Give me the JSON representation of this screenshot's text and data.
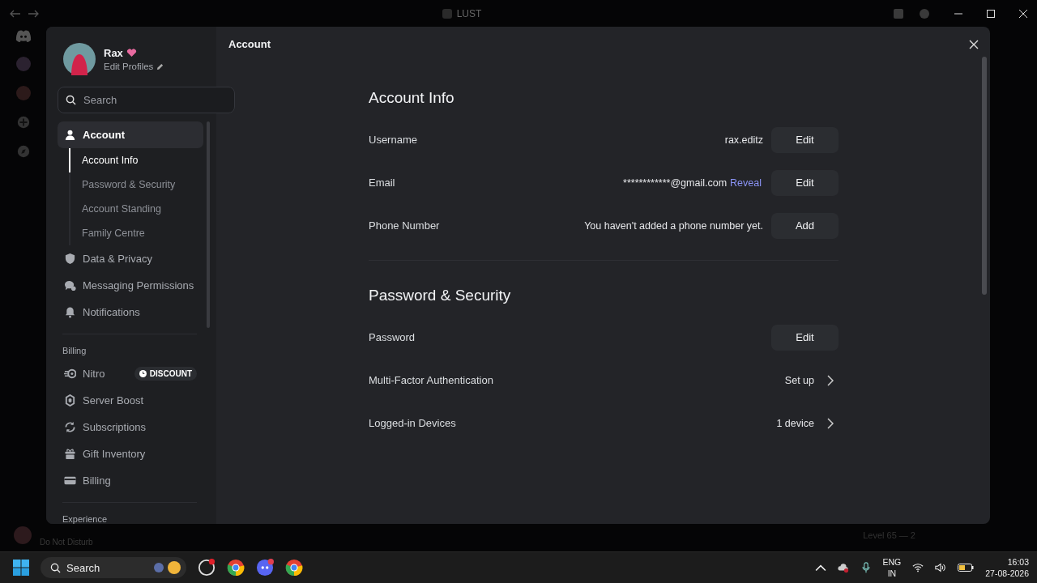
{
  "window": {
    "title": "LUST"
  },
  "background": {
    "status": "Do Not Disturb",
    "level_text": "Level 65 — 2"
  },
  "settings": {
    "profile": {
      "name": "Rax",
      "link": "Edit Profiles"
    },
    "search": {
      "placeholder": "Search"
    },
    "sections": [
      {
        "items": [
          {
            "label": "Account",
            "selected": true,
            "children": [
              {
                "label": "Account Info",
                "selected": true
              },
              {
                "label": "Password & Security",
                "selected": false
              },
              {
                "label": "Account Standing",
                "selected": false
              },
              {
                "label": "Family Centre",
                "selected": false
              }
            ]
          },
          {
            "label": "Data & Privacy",
            "selected": false
          },
          {
            "label": "Messaging Permissions",
            "selected": false
          },
          {
            "label": "Notifications",
            "selected": false
          }
        ]
      },
      {
        "header": "Billing",
        "items": [
          {
            "label": "Nitro",
            "selected": false,
            "badge": "DISCOUNT"
          },
          {
            "label": "Server Boost",
            "selected": false
          },
          {
            "label": "Subscriptions",
            "selected": false
          },
          {
            "label": "Gift Inventory",
            "selected": false
          },
          {
            "label": "Billing",
            "selected": false
          }
        ]
      },
      {
        "header": "Experience"
      }
    ],
    "page_title": "Account",
    "groups": [
      {
        "title": "Account Info",
        "rows": [
          {
            "kind": "button",
            "label": "Username",
            "value": "rax.editz",
            "action": "Edit"
          },
          {
            "kind": "button",
            "label": "Email",
            "value": "************@gmail.com",
            "link": "Reveal",
            "action": "Edit"
          },
          {
            "kind": "button",
            "label": "Phone Number",
            "value": "You haven't added a phone number yet.",
            "action": "Add"
          }
        ]
      },
      {
        "title": "Password & Security",
        "rows": [
          {
            "kind": "button",
            "label": "Password",
            "action": "Edit"
          },
          {
            "kind": "chevron",
            "label": "Multi-Factor Authentication",
            "value": "Set up"
          },
          {
            "kind": "chevron",
            "label": "Logged-in Devices",
            "value": "1 device"
          }
        ]
      }
    ]
  },
  "taskbar": {
    "search": {
      "placeholder": "Search"
    },
    "language": "ENG",
    "region": "IN",
    "time": "16:03",
    "date": "27-08-2026"
  }
}
